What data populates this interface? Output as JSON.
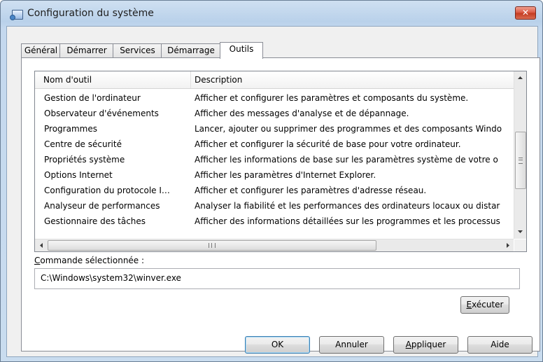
{
  "window": {
    "title": "Configuration du système",
    "close_label": "✕"
  },
  "tabs": [
    {
      "label": "Général"
    },
    {
      "label": "Démarrer"
    },
    {
      "label": "Services"
    },
    {
      "label": "Démarrage"
    },
    {
      "label": "Outils",
      "active": true
    }
  ],
  "tools_list": {
    "columns": {
      "name": "Nom d'outil",
      "description": "Description"
    },
    "rows": [
      {
        "name": "Gestion de l'ordinateur",
        "description": "Afficher et configurer les paramètres et composants du système."
      },
      {
        "name": "Observateur d'événements",
        "description": "Afficher des messages d'analyse et de dépannage."
      },
      {
        "name": "Programmes",
        "description": "Lancer, ajouter ou supprimer des programmes et des composants Windo"
      },
      {
        "name": "Centre de sécurité",
        "description": "Afficher et configurer la sécurité de base pour votre ordinateur."
      },
      {
        "name": "Propriétés système",
        "description": "Afficher les informations de base sur les paramètres système de votre o"
      },
      {
        "name": "Options Internet",
        "description": "Afficher les paramètres d'Internet Explorer."
      },
      {
        "name": "Configuration du protocole I…",
        "description": "Afficher et configurer les paramètres d'adresse réseau."
      },
      {
        "name": "Analyseur de performances",
        "description": "Analyser la fiabilité et les performances des ordinateurs locaux ou distar"
      },
      {
        "name": "Gestionnaire des tâches",
        "description": "Afficher des informations détaillées sur les programmes et les processus"
      }
    ]
  },
  "command": {
    "label_underlined": "C",
    "label_rest": "ommande sélectionnée :",
    "value": "C:\\Windows\\system32\\winver.exe"
  },
  "buttons": {
    "execute": {
      "underlined": "E",
      "rest": "xécuter"
    },
    "ok": "OK",
    "cancel": "Annuler",
    "apply": {
      "underlined": "A",
      "rest": "ppliquer"
    },
    "help": "Aide"
  },
  "colors": {
    "titlebar": "#b9d1ea",
    "close_button": "#c33a20",
    "default_button_border": "#3c7fb1"
  }
}
